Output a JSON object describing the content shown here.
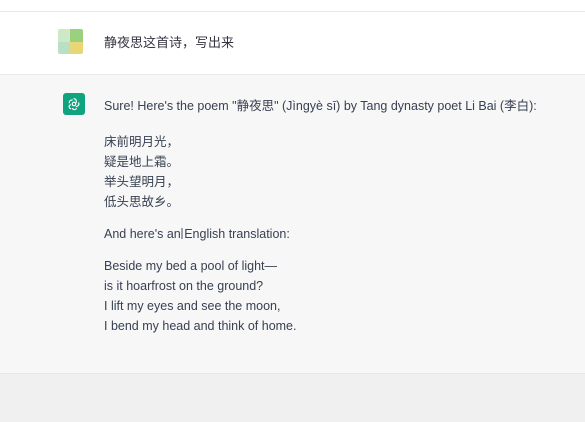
{
  "user_message": {
    "text": "静夜思这首诗，写出来"
  },
  "assistant_message": {
    "intro": "Sure! Here's the poem \"静夜思\" (Jìngyè sī) by Tang dynasty poet Li Bai (李白):",
    "poem_lines": [
      "床前明月光，",
      "疑是地上霜。",
      "举头望明月，",
      "低头思故乡。"
    ],
    "translation_intro": "And here's an English translation:",
    "translation_lines": [
      "Beside my bed a pool of light—",
      "is it hoarfrost on the ground?",
      "I lift my eyes and see the moon,",
      "I bend my head and think of home."
    ]
  },
  "colors": {
    "brand_green": "#10a37f",
    "assistant_bg": "#f7f7f8"
  }
}
